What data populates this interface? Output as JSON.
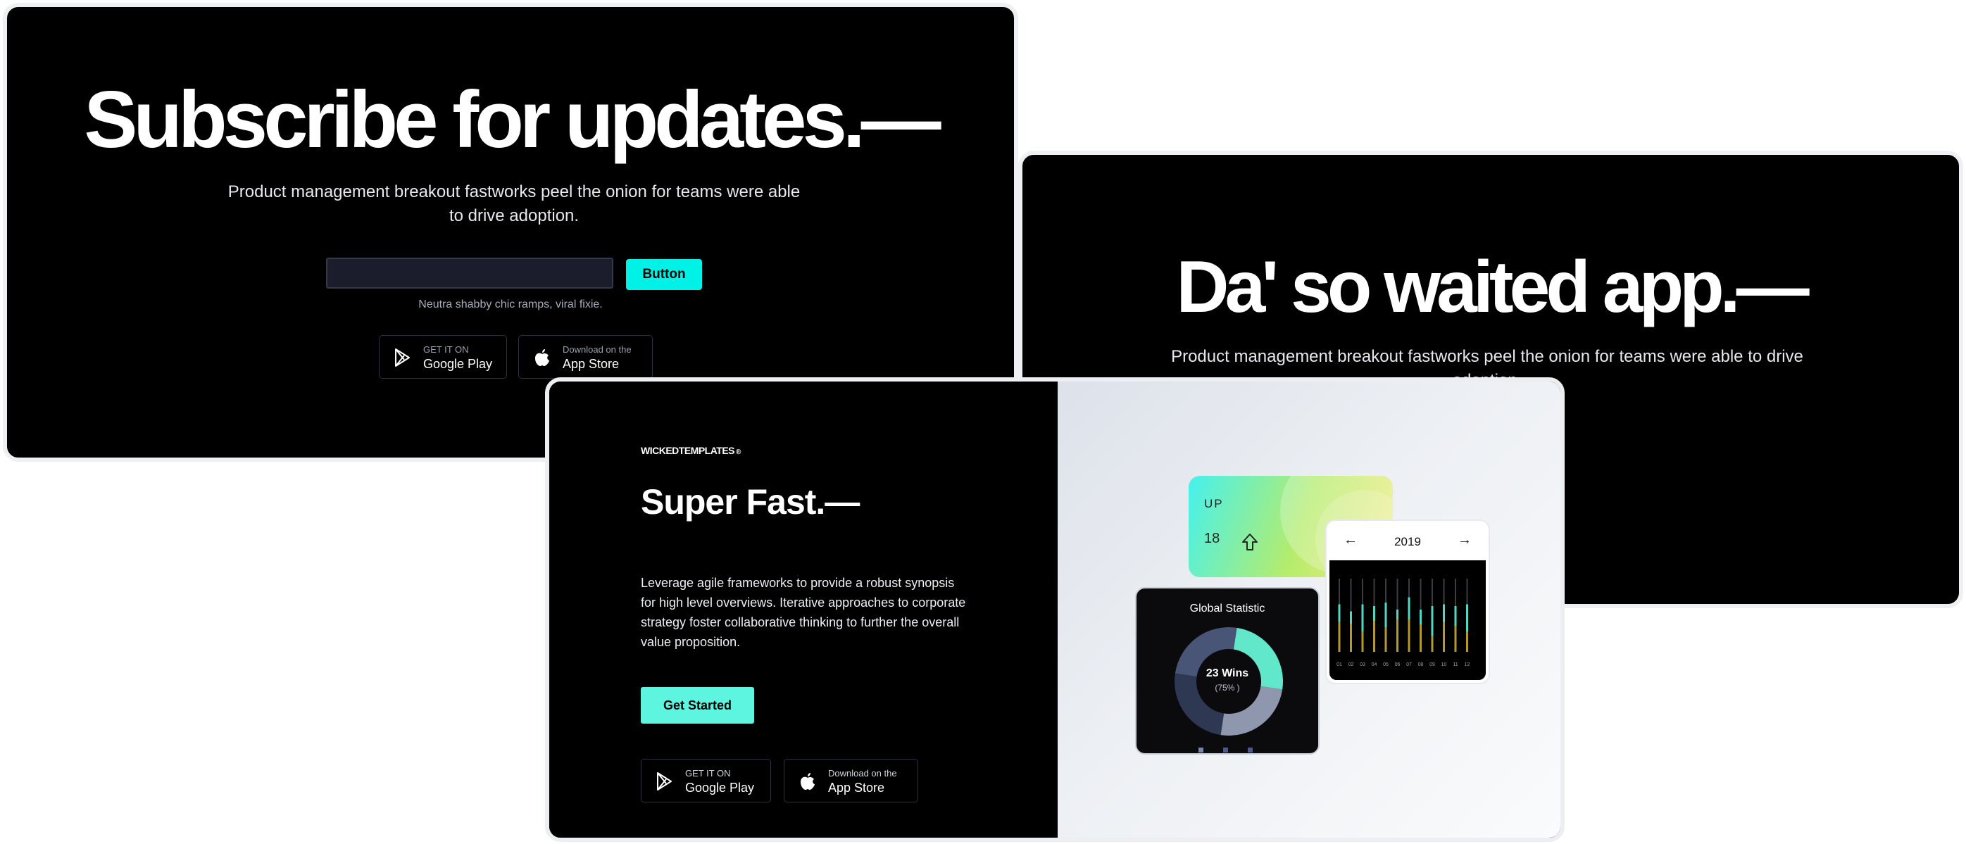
{
  "card1": {
    "title": "Subscribe for updates.—",
    "text": "Product management breakout fastworks peel the onion for teams were able to drive adoption.",
    "input_value": "",
    "input_placeholder": "",
    "button_label": "Button",
    "hint": "Neutra shabby chic ramps, viral fixie.",
    "google": {
      "small": "GET IT ON",
      "big": "Google Play"
    },
    "apple": {
      "small": "Download on the",
      "big": "App Store"
    }
  },
  "card2": {
    "title": "Da' so waited app.—",
    "text": "Product management breakout fastworks peel the onion for teams were able to drive adoption."
  },
  "card3": {
    "brand": "WICKEDTEMPLATES",
    "brand_mark": "®",
    "title": "Super Fast.—",
    "description": "Leverage agile frameworks to provide a robust synopsis for high level overviews. Iterative approaches to corporate strategy foster collaborative thinking to further the overall value proposition.",
    "cta_label": "Get Started",
    "google": {
      "small": "GET IT ON",
      "big": "Google Play"
    },
    "apple": {
      "small": "Download on the",
      "big": "App Store"
    },
    "widget_up": {
      "label": "UP",
      "value": "18",
      "icon": "arrow-up-icon"
    },
    "widget_donut": {
      "title": "Global Statistic",
      "center_main": "23 Wins",
      "center_sub": "(75% )",
      "segments": [
        {
          "name": "teal",
          "value": 25,
          "color": "#61e7c9"
        },
        {
          "name": "gray",
          "value": 25,
          "color": "#8e97ad"
        },
        {
          "name": "navy-dark",
          "value": 25,
          "color": "#2e3852"
        },
        {
          "name": "navy",
          "value": 25,
          "color": "#495577"
        }
      ]
    },
    "widget_bars": {
      "year": "2019",
      "prev": "←",
      "next": "→",
      "months": [
        "01",
        "02",
        "03",
        "04",
        "05",
        "06",
        "07",
        "08",
        "09",
        "10",
        "11",
        "12"
      ]
    }
  },
  "colors": {
    "accent": "#00f2e6",
    "cta": "#5ef5e0",
    "card_bg": "#000000"
  }
}
